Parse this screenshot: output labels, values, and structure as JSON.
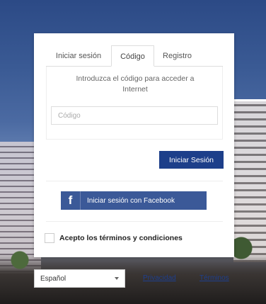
{
  "tabs": [
    {
      "label": "Iniciar sesión"
    },
    {
      "label": "Código"
    },
    {
      "label": "Registro"
    }
  ],
  "active_tab": "Código",
  "code_panel": {
    "instructions": "Introduzca el código para acceder a Internet",
    "code_placeholder": "Código",
    "code_value": ""
  },
  "login_button": "Iniciar Sesión",
  "facebook": {
    "icon": "facebook-icon",
    "label": "Iniciar sesión con Facebook"
  },
  "terms": {
    "label": "Acepto los términos y condiciones",
    "checked": false
  },
  "footer": {
    "language": "Español",
    "privacy_link": "Privacidad",
    "terms_link": "Términos"
  },
  "colors": {
    "primary": "#1d3f8a",
    "facebook": "#3b5998"
  }
}
